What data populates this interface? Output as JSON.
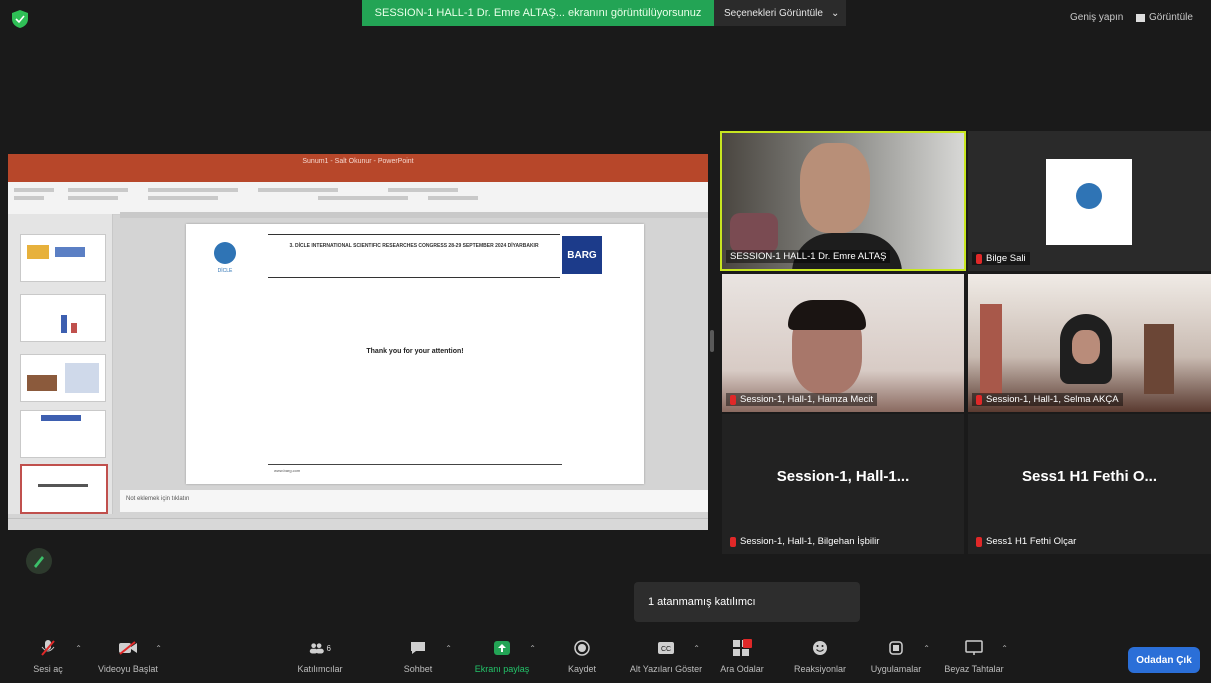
{
  "top": {
    "share_banner": "SESSION-1 HALL-1 Dr. Emre ALTAŞ... ekranını görüntülüyorsunuz",
    "view_options": "Seçenekleri Görüntüle",
    "exit_fullscreen": "Geniş yapın",
    "view": "Görüntüle"
  },
  "shared": {
    "window_title": "Sunum1 - Salt Okunur - PowerPoint",
    "slide_header": "3. DİCLE INTERNATIONAL SCIENTIFIC RESEARCHES CONGRESS 28-29 SEPTEMBER 2024 DİYARBAKIR",
    "logo_label": "DİCLE",
    "badge": "BARG",
    "thanks": "Thank you for your attention!",
    "footer": "www.barg.com",
    "notes": "Not eklemek için tıklatın"
  },
  "tiles": [
    {
      "name": "SESSION-1 HALL-1 Dr. Emre ALTAŞ",
      "muted": false,
      "active": true
    },
    {
      "name": "Bilge Sali",
      "muted": true
    },
    {
      "name": "Session-1, Hall-1, Hamza Mecit",
      "muted": true
    },
    {
      "name": "Session-1, Hall-1, Selma AKÇA",
      "muted": true
    },
    {
      "name": "Session-1, Hall-1, Bilgehan İşbilir",
      "muted": true,
      "display": "Session-1,  Hall-1..."
    },
    {
      "name": "Sess1 H1 Fethi Olçar",
      "muted": true,
      "display": "Sess1 H1 Fethi O..."
    }
  ],
  "tooltip": "1 atanmamış katılımcı",
  "toolbar": {
    "mute": "Sesi aç",
    "video": "Videoyu Başlat",
    "participants": "Katılımcılar",
    "participants_count": "6",
    "chat": "Sohbet",
    "share": "Ekranı paylaş",
    "record": "Kaydet",
    "captions": "Alt Yazıları Göster",
    "breakout": "Ara Odalar",
    "reactions": "Reaksiyonlar",
    "apps": "Uygulamalar",
    "whiteboard": "Beyaz Tahtalar",
    "leave": "Odadan Çık"
  },
  "colors": {
    "share_green": "#23a455",
    "active_border": "#c8e620",
    "leave_blue": "#2b6fd8",
    "muted_red": "#e02828"
  }
}
